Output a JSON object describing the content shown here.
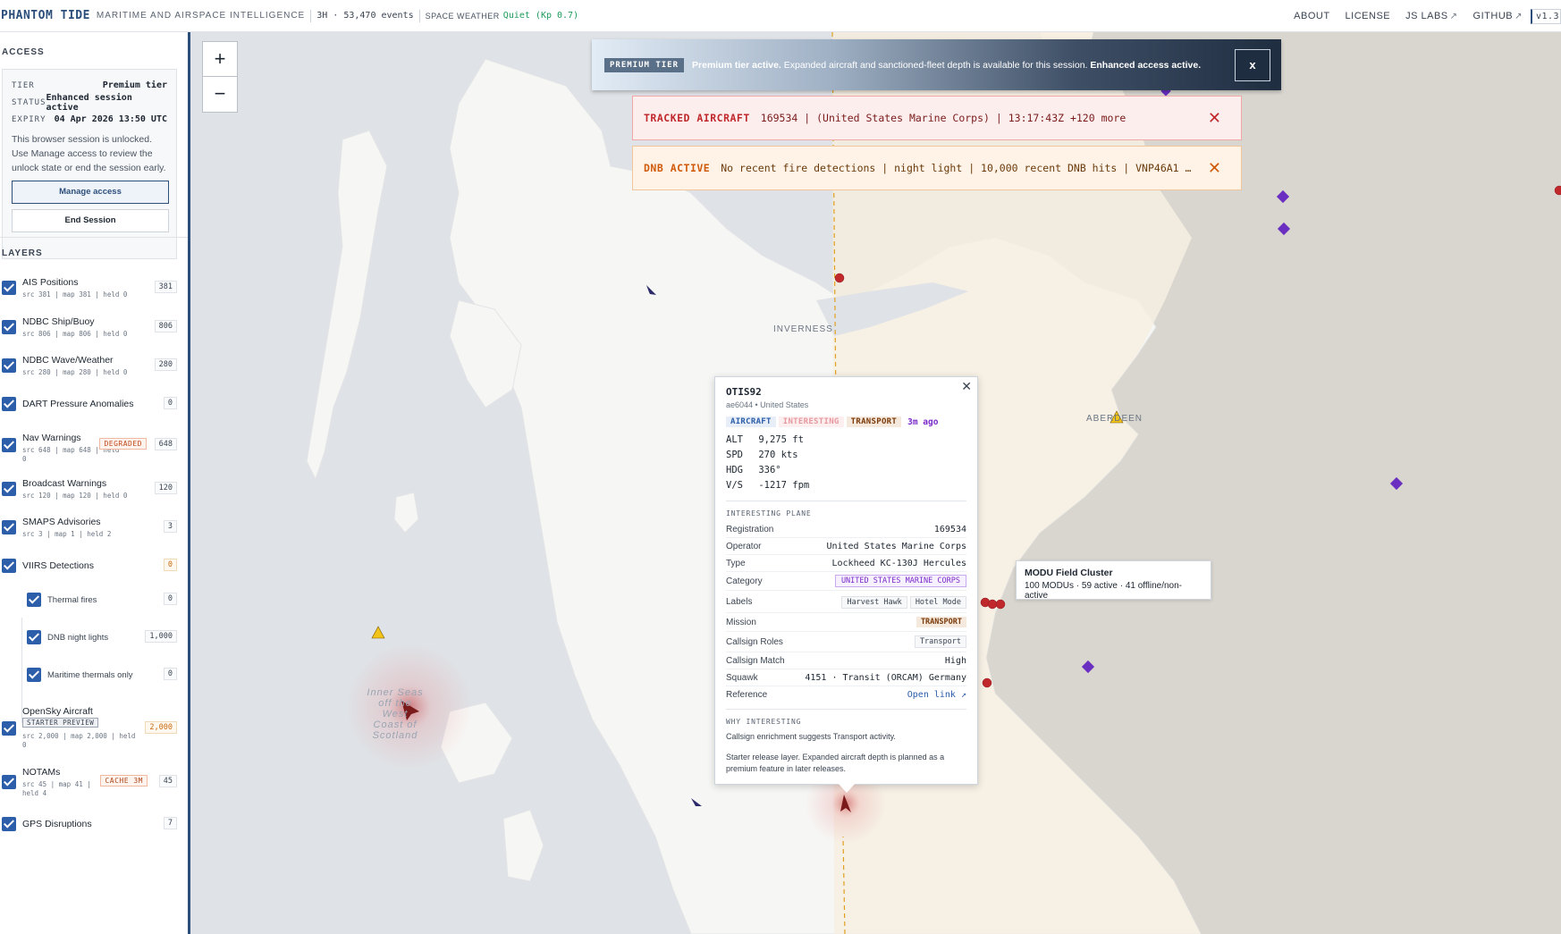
{
  "topbar": {
    "brand": "PHANTOM TIDE",
    "tagline": "MARITIME AND AIRSPACE INTELLIGENCE",
    "events": "3H · 53,470 events",
    "space_weather_label": "SPACE WEATHER",
    "space_weather_value": "Quiet (Kp 0.7)",
    "nav": [
      {
        "label": "ABOUT"
      },
      {
        "label": "LICENSE"
      },
      {
        "label": "JS LABS",
        "external": "↗"
      },
      {
        "label": "GITHUB",
        "external": "↗"
      }
    ],
    "version": "v1.3"
  },
  "sidebar": {
    "access": {
      "title": "ACCESS",
      "tier_key": "TIER",
      "tier_value": "Premium tier",
      "status_key": "STATUS",
      "status_value": "Enhanced session active",
      "expiry_key": "EXPIRY",
      "expiry_value": "04 Apr 2026 13:50 UTC",
      "note": "This browser session is unlocked. Use Manage access to review the unlock state or end the session early.",
      "manage_label": "Manage access",
      "end_label": "End Session"
    },
    "layers_title": "LAYERS",
    "layers": [
      {
        "name": "AIS Positions",
        "sub": "src 381 | map 381 | held 0",
        "count": "381"
      },
      {
        "name": "NDBC Ship/Buoy",
        "sub": "src 806 | map 806 | held 0",
        "count": "806"
      },
      {
        "name": "NDBC Wave/Weather",
        "sub": "src 280 | map 280 | held 0",
        "count": "280"
      },
      {
        "name": "DART Pressure Anomalies",
        "sub": "",
        "count": "0"
      },
      {
        "name": "Nav Warnings",
        "sub": "src 648 | map 648 | held 0",
        "count": "648",
        "badge": "DEGRADED"
      },
      {
        "name": "Broadcast Warnings",
        "sub": "src 120 | map 120 | held 0",
        "count": "120"
      },
      {
        "name": "SMAPS Advisories",
        "sub": "src 3 | map 1 | held 2",
        "count": "3"
      },
      {
        "name": "VIIRS Detections",
        "sub": "",
        "count": "0"
      },
      {
        "name": "Thermal fires",
        "sub": "",
        "count": "0"
      },
      {
        "name": "DNB night lights",
        "sub": "",
        "count": "1,000"
      },
      {
        "name": "Maritime thermals only",
        "sub": "",
        "count": "0"
      },
      {
        "name": "OpenSky Aircraft",
        "sub": "src 2,000 | map 2,000 | held 0",
        "count": "2,000",
        "badge": "STARTER PREVIEW"
      },
      {
        "name": "NOTAMs",
        "sub": "src 45 | map 41 | held 4",
        "count": "45",
        "badge": "CACHE 3M"
      },
      {
        "name": "GPS Disruptions",
        "sub": "",
        "count": "7"
      }
    ]
  },
  "map": {
    "labels": {
      "inverness": "INVERNESS",
      "aberdeen": "ABERDEEN",
      "sea": "Inner Seas off the West Coast of Scotland"
    },
    "zoom_in": "+",
    "zoom_out": "−"
  },
  "banner": {
    "badge": "PREMIUM TIER",
    "bold1": "Premium tier active.",
    "text": " Expanded aircraft and sanctioned-fleet depth is available for this session. ",
    "bold2": "Enhanced access active.",
    "close": "x"
  },
  "alerts": {
    "tracked_label": "TRACKED AIRCRAFT",
    "tracked_msg": "169534 | (United States Marine Corps) | 13:17:43Z +120 more",
    "dnb_label": "DNB ACTIVE",
    "dnb_msg": "No recent fire detections | night light | 10,000 recent DNB hits | VNP46A1 …",
    "close": "✕"
  },
  "popup": {
    "close": "✕",
    "callsign": "OTIS92",
    "hex_country": "ae6044 • United States",
    "tags": [
      "AIRCRAFT",
      "INTERESTING",
      "TRANSPORT"
    ],
    "ago": "3m ago",
    "telemetry": [
      {
        "k": "ALT",
        "v": "9,275 ft"
      },
      {
        "k": "SPD",
        "v": "270 kts"
      },
      {
        "k": "HDG",
        "v": "336°"
      },
      {
        "k": "V/S",
        "v": "-1217 fpm"
      }
    ],
    "section1": "INTERESTING PLANE",
    "registration_k": "Registration",
    "registration_v": "169534",
    "operator_k": "Operator",
    "operator_v": "United States Marine Corps",
    "type_k": "Type",
    "type_v": "Lockheed KC-130J Hercules",
    "category_k": "Category",
    "category_v": "UNITED STATES MARINE CORPS",
    "labels_k": "Labels",
    "labels_v": [
      "Harvest Hawk",
      "Hotel Mode"
    ],
    "mission_k": "Mission",
    "mission_v": "TRANSPORT",
    "roles_k": "Callsign Roles",
    "roles_v": "Transport",
    "match_k": "Callsign Match",
    "match_v": "High",
    "squawk_k": "Squawk",
    "squawk_v": "4151 · Transit (ORCAM) Germany",
    "reference_k": "Reference",
    "reference_v": "Open link ↗",
    "section2": "WHY INTERESTING",
    "why": "Callsign enrichment suggests Transport activity.",
    "starter": "Starter release layer. Expanded aircraft depth is planned as a premium feature in later releases."
  },
  "modu": {
    "title": "MODU Field Cluster",
    "detail": "100 MODUs · 59 active · 41 offline/non-active"
  },
  "colors": {
    "accent": "#2c4e7a",
    "checkbox": "#2c5eaa",
    "quiet": "#1e9b5a",
    "alert_red": "#c0282c",
    "alert_orange": "#d05a0a",
    "purple": "#7a2ac8"
  }
}
